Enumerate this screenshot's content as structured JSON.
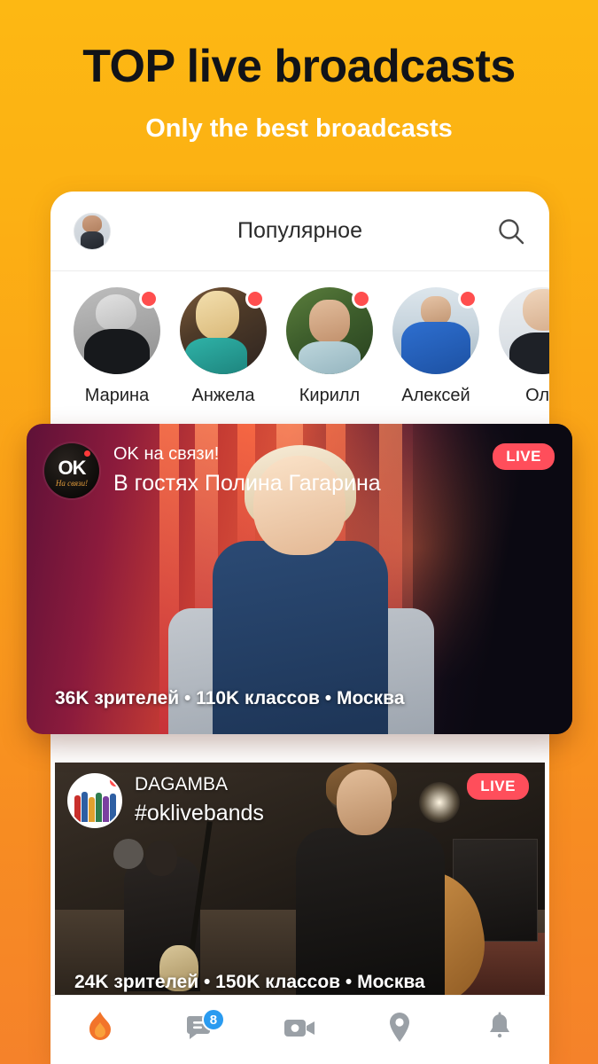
{
  "promo": {
    "headline": "TOP live broadcasts",
    "subheadline": "Only the best broadcasts",
    "headline_color": "#111318",
    "subheadline_color": "#FFFFFF",
    "background_top_color": "#FDB813",
    "background_bottom_color": "#F5822A"
  },
  "app": {
    "appbar": {
      "title": "Популярное",
      "avatar_icon": "user-avatar",
      "search_icon": "search-icon"
    },
    "stories": [
      {
        "name": "Марина",
        "live": true
      },
      {
        "name": "Анжела",
        "live": true
      },
      {
        "name": "Кирилл",
        "live": true
      },
      {
        "name": "Алексей",
        "live": true
      },
      {
        "name": "Оля",
        "live": false
      }
    ],
    "featured_card": {
      "channel_logo_text": "OK",
      "channel_logo_sub": "На связи!",
      "subtitle": "OK на связи!",
      "title": "В гостях Полина Гагарина",
      "live_label": "LIVE",
      "stats": "36K зрителей  •  110K классов  •  Москва",
      "viewers": "36K зрителей",
      "likes": "110K классов",
      "city": "Москва",
      "live_color": "#FF4E5B"
    },
    "second_card": {
      "channel_name": "DAGAMBA",
      "hashtag": "#oklivebands",
      "live_label": "LIVE",
      "stats": "24K зрителей  •  150K классов  •  Москва",
      "viewers": "24K зрителей",
      "likes": "150K классов",
      "city": "Москва",
      "live_color": "#FF4E5B"
    },
    "bottom_nav": [
      {
        "icon": "flame-icon",
        "label": "",
        "active": true,
        "badge": ""
      },
      {
        "icon": "chat-messages-icon",
        "label": "",
        "active": false,
        "badge": "8"
      },
      {
        "icon": "video-camera-icon",
        "label": "",
        "active": false,
        "badge": ""
      },
      {
        "icon": "location-pin-icon",
        "label": "",
        "active": false,
        "badge": ""
      },
      {
        "icon": "bell-icon",
        "label": "",
        "active": false,
        "badge": ""
      }
    ],
    "badge_color": "#2A9BF0",
    "active_nav_color": "#F2742A",
    "inactive_nav_color": "#9AA0A6"
  }
}
